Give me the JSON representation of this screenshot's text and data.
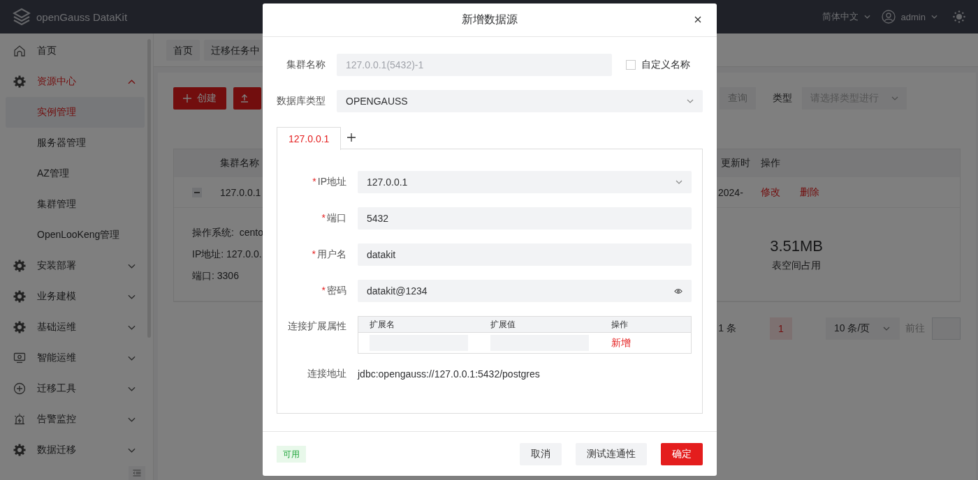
{
  "header": {
    "brand": "openGauss DataKit",
    "language": "简体中文",
    "user": "admin"
  },
  "sidebar": {
    "items": [
      {
        "label": "首页",
        "selected": false
      },
      {
        "label": "资源中心",
        "expanded": true,
        "children": [
          {
            "label": "实例管理",
            "selected": true
          },
          {
            "label": "服务器管理",
            "selected": false
          },
          {
            "label": "AZ管理",
            "selected": false
          },
          {
            "label": "集群管理",
            "selected": false
          },
          {
            "label": "OpenLooKeng管理",
            "selected": false
          }
        ]
      },
      {
        "label": "安装部署",
        "expanded": false
      },
      {
        "label": "业务建模",
        "expanded": false
      },
      {
        "label": "基础运维",
        "expanded": false
      },
      {
        "label": "智能运维",
        "expanded": false
      },
      {
        "label": "迁移工具",
        "expanded": false
      },
      {
        "label": "告警监控",
        "expanded": false
      },
      {
        "label": "数据迁移",
        "expanded": false
      }
    ]
  },
  "breadcrumb_tabs": [
    {
      "label": "首页"
    },
    {
      "label": "迁移任务中"
    }
  ],
  "toolbar": {
    "create_button": "创建",
    "query_button": "查询",
    "type_label": "类型",
    "type_placeholder": "请选择类型进行"
  },
  "table": {
    "columns": [
      "集群名称",
      "更新时",
      "操作"
    ],
    "rows": [
      {
        "expanded": true,
        "cluster_name": "127.0.0.1",
        "updated": "2024-",
        "actions": [
          "修改",
          "删除"
        ],
        "details": [
          "操作系统:  cento",
          "IP地址: 127.0.0.",
          "端口: 3306"
        ],
        "tablespace_size": "3.51MB",
        "tablespace_label": "表空间占用"
      }
    ]
  },
  "pagination": {
    "total": "1 条",
    "pages": [
      {
        "label": "1",
        "selected": true
      }
    ],
    "page_size": "10 条/页",
    "goto_label": "前往"
  },
  "dialog": {
    "title": "新增数据源",
    "cluster_name": {
      "label": "集群名称",
      "value": "127.0.0.1(5432)-1",
      "disabled": true
    },
    "custom_name": {
      "label": "自定义名称",
      "checked": false
    },
    "db_type": {
      "label": "数据库类型",
      "value": "OPENGAUSS"
    },
    "host_tabs": [
      {
        "label": "127.0.0.1",
        "selected": true
      }
    ],
    "fields": [
      {
        "kind": "select",
        "label": "IP地址",
        "required_mark": "*",
        "value": "127.0.0.1"
      },
      {
        "kind": "text",
        "label": "端口",
        "required_mark": "*",
        "value": "5432"
      },
      {
        "kind": "text",
        "label": "用户名",
        "required_mark": "*",
        "value": "datakit"
      },
      {
        "kind": "password",
        "label": "密码",
        "required_mark": "*",
        "value": "datakit@1234"
      }
    ],
    "ext_props": {
      "label": "连接扩展属性",
      "columns": [
        "扩展名",
        "扩展值",
        "操作"
      ],
      "add_link": "新增"
    },
    "url": {
      "label": "连接地址",
      "value": "jdbc:opengauss://127.0.0.1:5432/postgres"
    },
    "status_tag": "可用",
    "buttons": [
      {
        "label": "取消",
        "kind": "default"
      },
      {
        "label": "测试连通性",
        "kind": "default"
      },
      {
        "label": "确定",
        "kind": "primary"
      }
    ]
  }
}
